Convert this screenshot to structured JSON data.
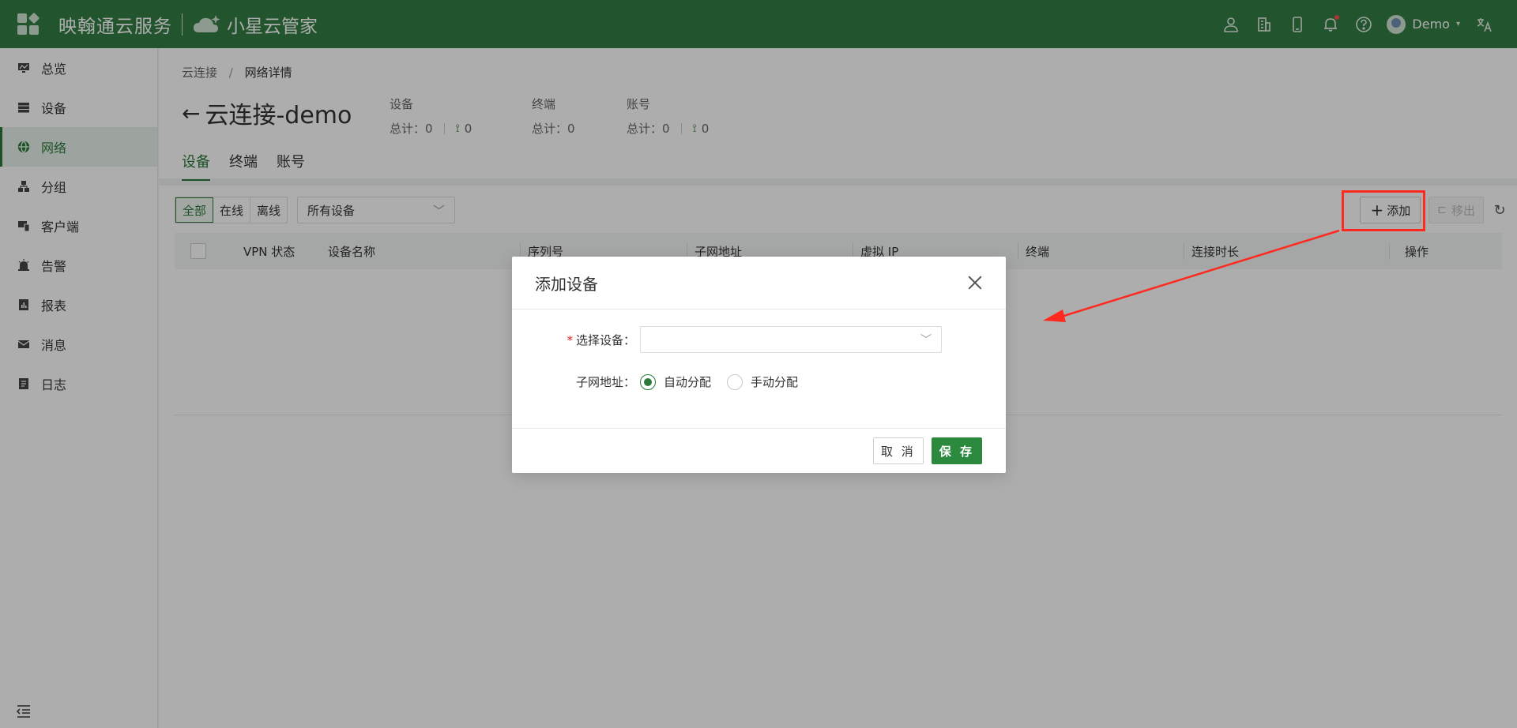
{
  "topbar": {
    "brand": "映翰通云服务",
    "product": "小星云管家",
    "user": "Demo"
  },
  "sidebar": {
    "items": [
      {
        "label": "总览",
        "icon": "monitor-icon"
      },
      {
        "label": "设备",
        "icon": "server-icon"
      },
      {
        "label": "网络",
        "icon": "globe-icon"
      },
      {
        "label": "分组",
        "icon": "hierarchy-icon"
      },
      {
        "label": "客户端",
        "icon": "devices-icon"
      },
      {
        "label": "告警",
        "icon": "alarm-icon"
      },
      {
        "label": "报表",
        "icon": "report-icon"
      },
      {
        "label": "消息",
        "icon": "mail-icon"
      },
      {
        "label": "日志",
        "icon": "log-icon"
      }
    ],
    "active_index": 2
  },
  "breadcrumb": {
    "parent": "云连接",
    "separator": "/",
    "current": "网络详情"
  },
  "page": {
    "title": "云连接-demo"
  },
  "stats": {
    "device": {
      "label": "设备",
      "total": "总计：0",
      "online": "0"
    },
    "terminal": {
      "label": "终端",
      "total": "总计：0"
    },
    "account": {
      "label": "账号",
      "total": "总计：0",
      "online": "0"
    }
  },
  "tabs": [
    "设备",
    "终端",
    "账号"
  ],
  "toolbar": {
    "filters": [
      "全部",
      "在线",
      "离线"
    ],
    "device_select": "所有设备",
    "add_label": "添加",
    "remove_label": "移出"
  },
  "table": {
    "columns": [
      "VPN 状态",
      "设备名称",
      "序列号",
      "子网地址",
      "虚拟 IP",
      "终端",
      "连接时长",
      "操作"
    ]
  },
  "modal": {
    "title": "添加设备",
    "select_label": "选择设备：",
    "select_value": "",
    "subnet_label": "子网地址：",
    "radio_auto": "自动分配",
    "radio_manual": "手动分配",
    "cancel_label": "取 消",
    "save_label": "保 存"
  },
  "colors": {
    "brand": "#337c43",
    "accent": "#2b7a3a",
    "highlight": "#ff2a1f"
  }
}
